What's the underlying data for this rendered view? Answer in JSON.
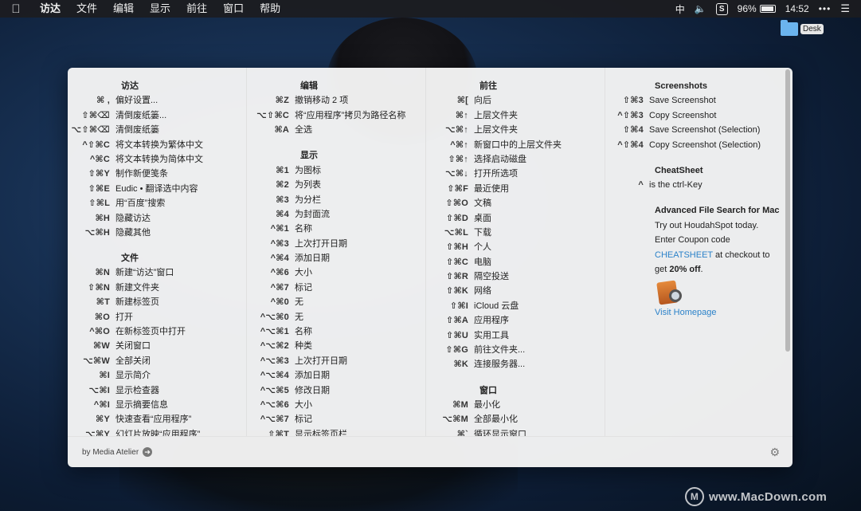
{
  "menubar": {
    "apple": "",
    "items": [
      "访达",
      "文件",
      "编辑",
      "显示",
      "前往",
      "窗口",
      "帮助"
    ],
    "status": {
      "ime": "中",
      "volume": "🔈",
      "s_app": "S",
      "battery": "96%",
      "time": "14:52",
      "dots": "•••",
      "menu": "☰"
    }
  },
  "desktop": {
    "folder_label": "Desk"
  },
  "columns": [
    {
      "sections": [
        {
          "title": "访达",
          "rows": [
            {
              "keys": "⌘ ,",
              "label": "偏好设置..."
            },
            {
              "keys": "⇧⌘⌫",
              "label": "清倒废纸篓..."
            },
            {
              "keys": "⌥⇧⌘⌫",
              "label": "清倒废纸篓"
            },
            {
              "keys": "^⇧⌘C",
              "label": "将文本转换为繁体中文"
            },
            {
              "keys": "^⌘C",
              "label": "将文本转换为简体中文"
            },
            {
              "keys": "⇧⌘Y",
              "label": "制作新便笺条"
            },
            {
              "keys": "⇧⌘E",
              "label": "Eudic • 翻译选中内容"
            },
            {
              "keys": "⇧⌘L",
              "label": "用“百度”搜索"
            },
            {
              "keys": "⌘H",
              "label": "隐藏访达"
            },
            {
              "keys": "⌥⌘H",
              "label": "隐藏其他"
            }
          ]
        },
        {
          "title": "文件",
          "rows": [
            {
              "keys": "⌘N",
              "label": "新建“访达”窗口"
            },
            {
              "keys": "⇧⌘N",
              "label": "新建文件夹"
            },
            {
              "keys": "⌘T",
              "label": "新建标签页"
            },
            {
              "keys": "⌘O",
              "label": "打开"
            },
            {
              "keys": "^⌘O",
              "label": "在新标签页中打开"
            },
            {
              "keys": "⌘W",
              "label": "关闭窗口"
            },
            {
              "keys": "⌥⌘W",
              "label": "全部关闭"
            },
            {
              "keys": "⌘I",
              "label": "显示简介"
            },
            {
              "keys": "⌥⌘I",
              "label": "显示检查器"
            },
            {
              "keys": "^⌘I",
              "label": "显示摘要信息"
            },
            {
              "keys": "⌘Y",
              "label": "快速查看“应用程序”"
            },
            {
              "keys": "⌥⌘Y",
              "label": "幻灯片放映“应用程序”"
            }
          ]
        }
      ]
    },
    {
      "sections": [
        {
          "title": "编辑",
          "rows": [
            {
              "keys": "⌘Z",
              "label": "撤销移动 2 项"
            },
            {
              "keys": "⌥⇧⌘C",
              "label": "将“应用程序”拷贝为路径名称"
            },
            {
              "keys": "⌘A",
              "label": "全选"
            }
          ]
        },
        {
          "title": "显示",
          "rows": [
            {
              "keys": "⌘1",
              "label": "为图标"
            },
            {
              "keys": "⌘2",
              "label": "为列表"
            },
            {
              "keys": "⌘3",
              "label": "为分栏"
            },
            {
              "keys": "⌘4",
              "label": "为封面流"
            },
            {
              "keys": "^⌘1",
              "label": "名称"
            },
            {
              "keys": "^⌘3",
              "label": "上次打开日期"
            },
            {
              "keys": "^⌘4",
              "label": "添加日期"
            },
            {
              "keys": "^⌘6",
              "label": "大小"
            },
            {
              "keys": "^⌘7",
              "label": "标记"
            },
            {
              "keys": "^⌘0",
              "label": "无"
            },
            {
              "keys": "^⌥⌘0",
              "label": "无"
            },
            {
              "keys": "^⌥⌘1",
              "label": "名称"
            },
            {
              "keys": "^⌥⌘2",
              "label": "种类"
            },
            {
              "keys": "^⌥⌘3",
              "label": "上次打开日期"
            },
            {
              "keys": "^⌥⌘4",
              "label": "添加日期"
            },
            {
              "keys": "^⌥⌘5",
              "label": "修改日期"
            },
            {
              "keys": "^⌥⌘6",
              "label": "大小"
            },
            {
              "keys": "^⌥⌘7",
              "label": "标记"
            },
            {
              "keys": "⇧⌘T",
              "label": "显示标签页栏"
            }
          ]
        }
      ]
    },
    {
      "sections": [
        {
          "title": "前往",
          "rows": [
            {
              "keys": "⌘[",
              "label": "向后"
            },
            {
              "keys": "⌘↑",
              "label": "上层文件夹"
            },
            {
              "keys": "⌥⌘↑",
              "label": "上层文件夹"
            },
            {
              "keys": "^⌘↑",
              "label": "新窗口中的上层文件夹"
            },
            {
              "keys": "⇧⌘↑",
              "label": "选择启动磁盘"
            },
            {
              "keys": "⌥⌘↓",
              "label": "打开所选项"
            },
            {
              "keys": "⇧⌘F",
              "label": "最近使用"
            },
            {
              "keys": "⇧⌘O",
              "label": "文稿"
            },
            {
              "keys": "⇧⌘D",
              "label": "桌面"
            },
            {
              "keys": "⌥⌘L",
              "label": "下载"
            },
            {
              "keys": "⇧⌘H",
              "label": "个人"
            },
            {
              "keys": "⇧⌘C",
              "label": "电脑"
            },
            {
              "keys": "⇧⌘R",
              "label": "隔空投送"
            },
            {
              "keys": "⇧⌘K",
              "label": "网络"
            },
            {
              "keys": "⇧⌘I",
              "label": "iCloud 云盘"
            },
            {
              "keys": "⇧⌘A",
              "label": "应用程序"
            },
            {
              "keys": "⇧⌘U",
              "label": "实用工具"
            },
            {
              "keys": "⇧⌘G",
              "label": "前往文件夹..."
            },
            {
              "keys": "⌘K",
              "label": "连接服务器..."
            }
          ]
        },
        {
          "title": "窗口",
          "rows": [
            {
              "keys": "⌘M",
              "label": "最小化"
            },
            {
              "keys": "⌥⌘M",
              "label": "全部最小化"
            },
            {
              "keys": "⌘`",
              "label": "循环显示窗口"
            }
          ]
        }
      ]
    }
  ],
  "sidebar": {
    "screenshots_title": "Screenshots",
    "screenshots": [
      {
        "keys": "⇧⌘3",
        "label": "Save Screenshot"
      },
      {
        "keys": "^⇧⌘3",
        "label": "Copy Screenshot"
      },
      {
        "keys": "⇧⌘4",
        "label": "Save Screenshot (Selection)"
      },
      {
        "keys": "^⇧⌘4",
        "label": "Copy Screenshot (Selection)"
      }
    ],
    "cheatsheet_title": "CheatSheet",
    "cheatsheet_row": {
      "keys": "^",
      "label": "is the ctrl-Key"
    },
    "promo_title": "Advanced File Search for Mac",
    "promo_line1": "Try out HoudahSpot today.",
    "promo_line2": "Enter Coupon code",
    "promo_code": "CHEATSHEET",
    "promo_line3_suffix": " at checkout to",
    "promo_get": "get ",
    "promo_discount": "20% off",
    "promo_period": ".",
    "homepage_link": "Visit Homepage"
  },
  "footer": {
    "credit": "by Media Atelier",
    "credit_arrow": "➔",
    "gear": "⚙"
  },
  "watermark": {
    "logo": "M",
    "text": "www.MacDown.com"
  },
  "colors": {
    "link": "#2b82c9",
    "panel": "#f4f4f4"
  }
}
